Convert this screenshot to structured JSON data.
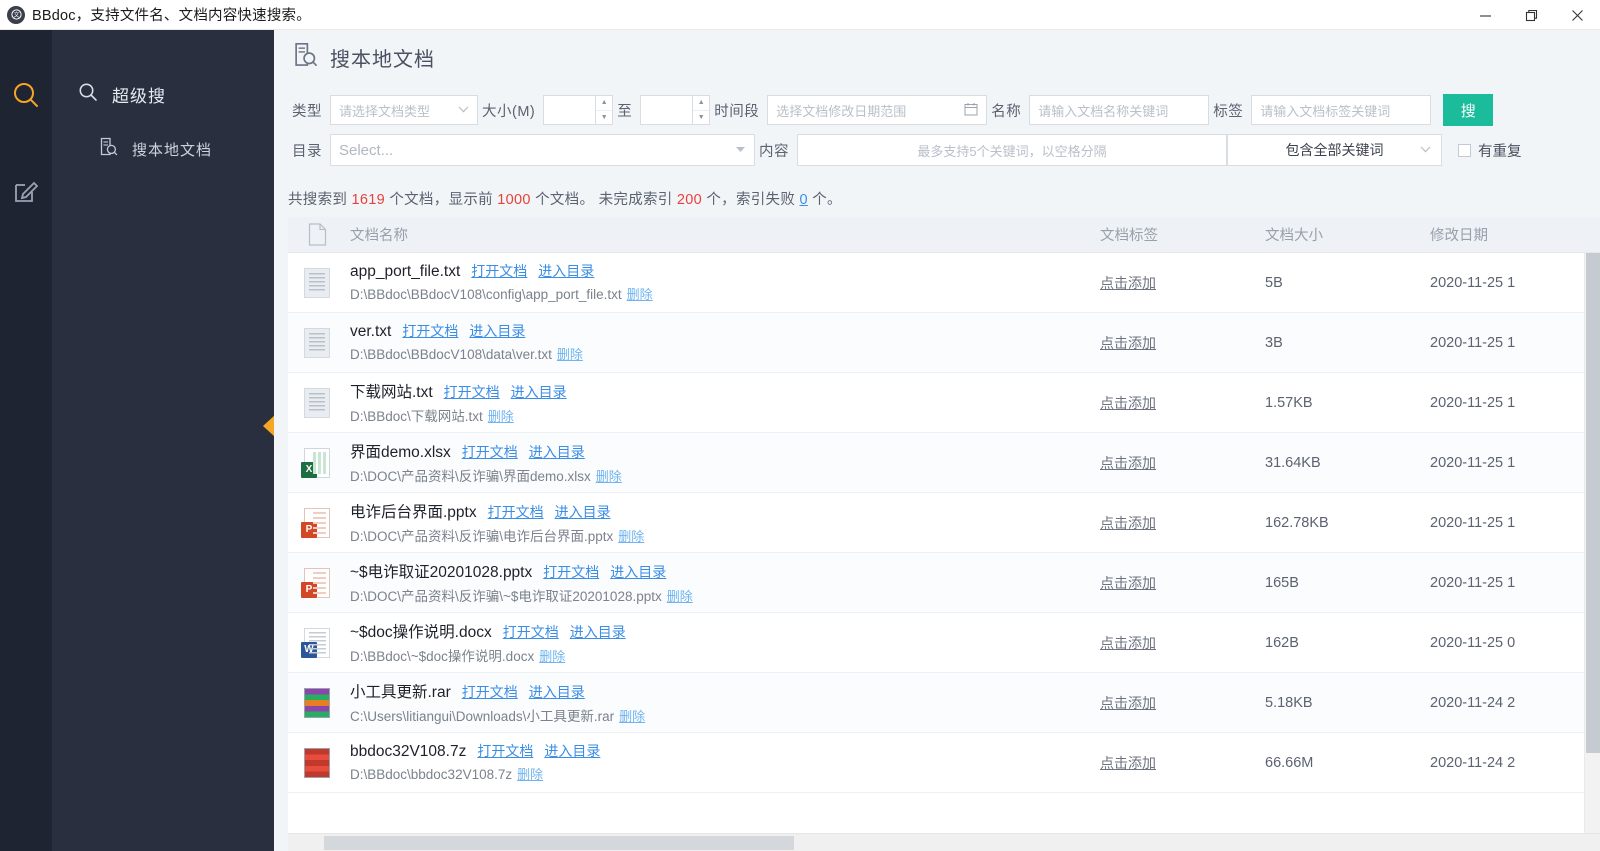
{
  "window": {
    "title": "BBdoc，支持文件名、文档内容快速搜索。",
    "logo_glyph": "◉",
    "minimize": "—",
    "maximize": "❐",
    "close": "✕"
  },
  "rail": {
    "items": [
      {
        "name": "search-icon",
        "active": true
      },
      {
        "name": "edit-icon",
        "active": false
      }
    ]
  },
  "sidebar": {
    "group_label": "超级搜",
    "items": [
      {
        "label": "搜本地文档",
        "icon": "doc-search-icon"
      }
    ]
  },
  "page": {
    "title": "搜本地文档",
    "icon": "doc-search-icon"
  },
  "filters": {
    "type_label": "类型",
    "type_placeholder": "请选择文档类型",
    "size_label": "大小(M)",
    "size_from": "",
    "size_to": "",
    "size_between": "至",
    "date_label": "时间段",
    "date_placeholder": "选择文档修改日期范围",
    "name_label": "名称",
    "name_placeholder": "请输入文档名称关键词",
    "tag_label": "标签",
    "tag_placeholder": "请输入文档标签关键词",
    "search_button": "搜",
    "dir_label": "目录",
    "dir_placeholder": "Select...",
    "content_label": "内容",
    "content_placeholder": "最多支持5个关键词，以空格分隔",
    "keyword_mode": "包含全部关键词",
    "duplicate_label": "有重复",
    "duplicate_checked": false
  },
  "status": {
    "prefix": "共搜索到 ",
    "total": "1619",
    "mid1": " 个文档，显示前 ",
    "shown": "1000",
    "mid2": " 个文档。 未完成索引 ",
    "pending": "200",
    "mid3": " 个，索引失败 ",
    "failed": "0",
    "suffix": " 个。"
  },
  "table": {
    "headers": {
      "icon": "file-icon",
      "name": "文档名称",
      "tag": "文档标签",
      "size": "文档大小",
      "date": "修改日期"
    },
    "actions": {
      "open": "打开文档",
      "goto": "进入目录",
      "delete": "删除",
      "add_tag": "点击添加"
    },
    "rows": [
      {
        "icon": "txt",
        "name": "app_port_file.txt",
        "path": "D:\\BBdoc\\BBdocV108\\config\\app_port_file.txt",
        "tag": "点击添加",
        "size": "5B",
        "date": "2020-11-25 1"
      },
      {
        "icon": "txt",
        "name": "ver.txt",
        "path": "D:\\BBdoc\\BBdocV108\\data\\ver.txt",
        "tag": "点击添加",
        "size": "3B",
        "date": "2020-11-25 1"
      },
      {
        "icon": "txt",
        "name": "下载网站.txt",
        "path": "D:\\BBdoc\\下载网站.txt",
        "tag": "点击添加",
        "size": "1.57KB",
        "date": "2020-11-25 1"
      },
      {
        "icon": "xls",
        "name": "界面demo.xlsx",
        "path": "D:\\DOC\\产品资料\\反诈骗\\界面demo.xlsx",
        "tag": "点击添加",
        "size": "31.64KB",
        "date": "2020-11-25 1"
      },
      {
        "icon": "ppt",
        "name": "电诈后台界面.pptx",
        "path": "D:\\DOC\\产品资料\\反诈骗\\电诈后台界面.pptx",
        "tag": "点击添加",
        "size": "162.78KB",
        "date": "2020-11-25 1"
      },
      {
        "icon": "ppt",
        "name": "~$电诈取证20201028.pptx",
        "path": "D:\\DOC\\产品资料\\反诈骗\\~$电诈取证20201028.pptx",
        "tag": "点击添加",
        "size": "165B",
        "date": "2020-11-25 1"
      },
      {
        "icon": "doc",
        "name": "~$doc操作说明.docx",
        "path": "D:\\BBdoc\\~$doc操作说明.docx",
        "tag": "点击添加",
        "size": "162B",
        "date": "2020-11-25 0"
      },
      {
        "icon": "rar",
        "name": "小工具更新.rar",
        "path": "C:\\Users\\litiangui\\Downloads\\小工具更新.rar",
        "tag": "点击添加",
        "size": "5.18KB",
        "date": "2020-11-24 2"
      },
      {
        "icon": "sevenz",
        "name": "bbdoc32V108.7z",
        "path": "D:\\BBdoc\\bbdoc32V108.7z",
        "tag": "点击添加",
        "size": "66.66M",
        "date": "2020-11-24 2"
      }
    ]
  },
  "colors": {
    "rail_bg": "#1f2433",
    "nav_bg": "#2a2f3f",
    "accent_orange": "#f5a623",
    "search_green": "#1abc9c",
    "link_blue": "#3a8ee6",
    "hot_red": "#e8413a"
  }
}
